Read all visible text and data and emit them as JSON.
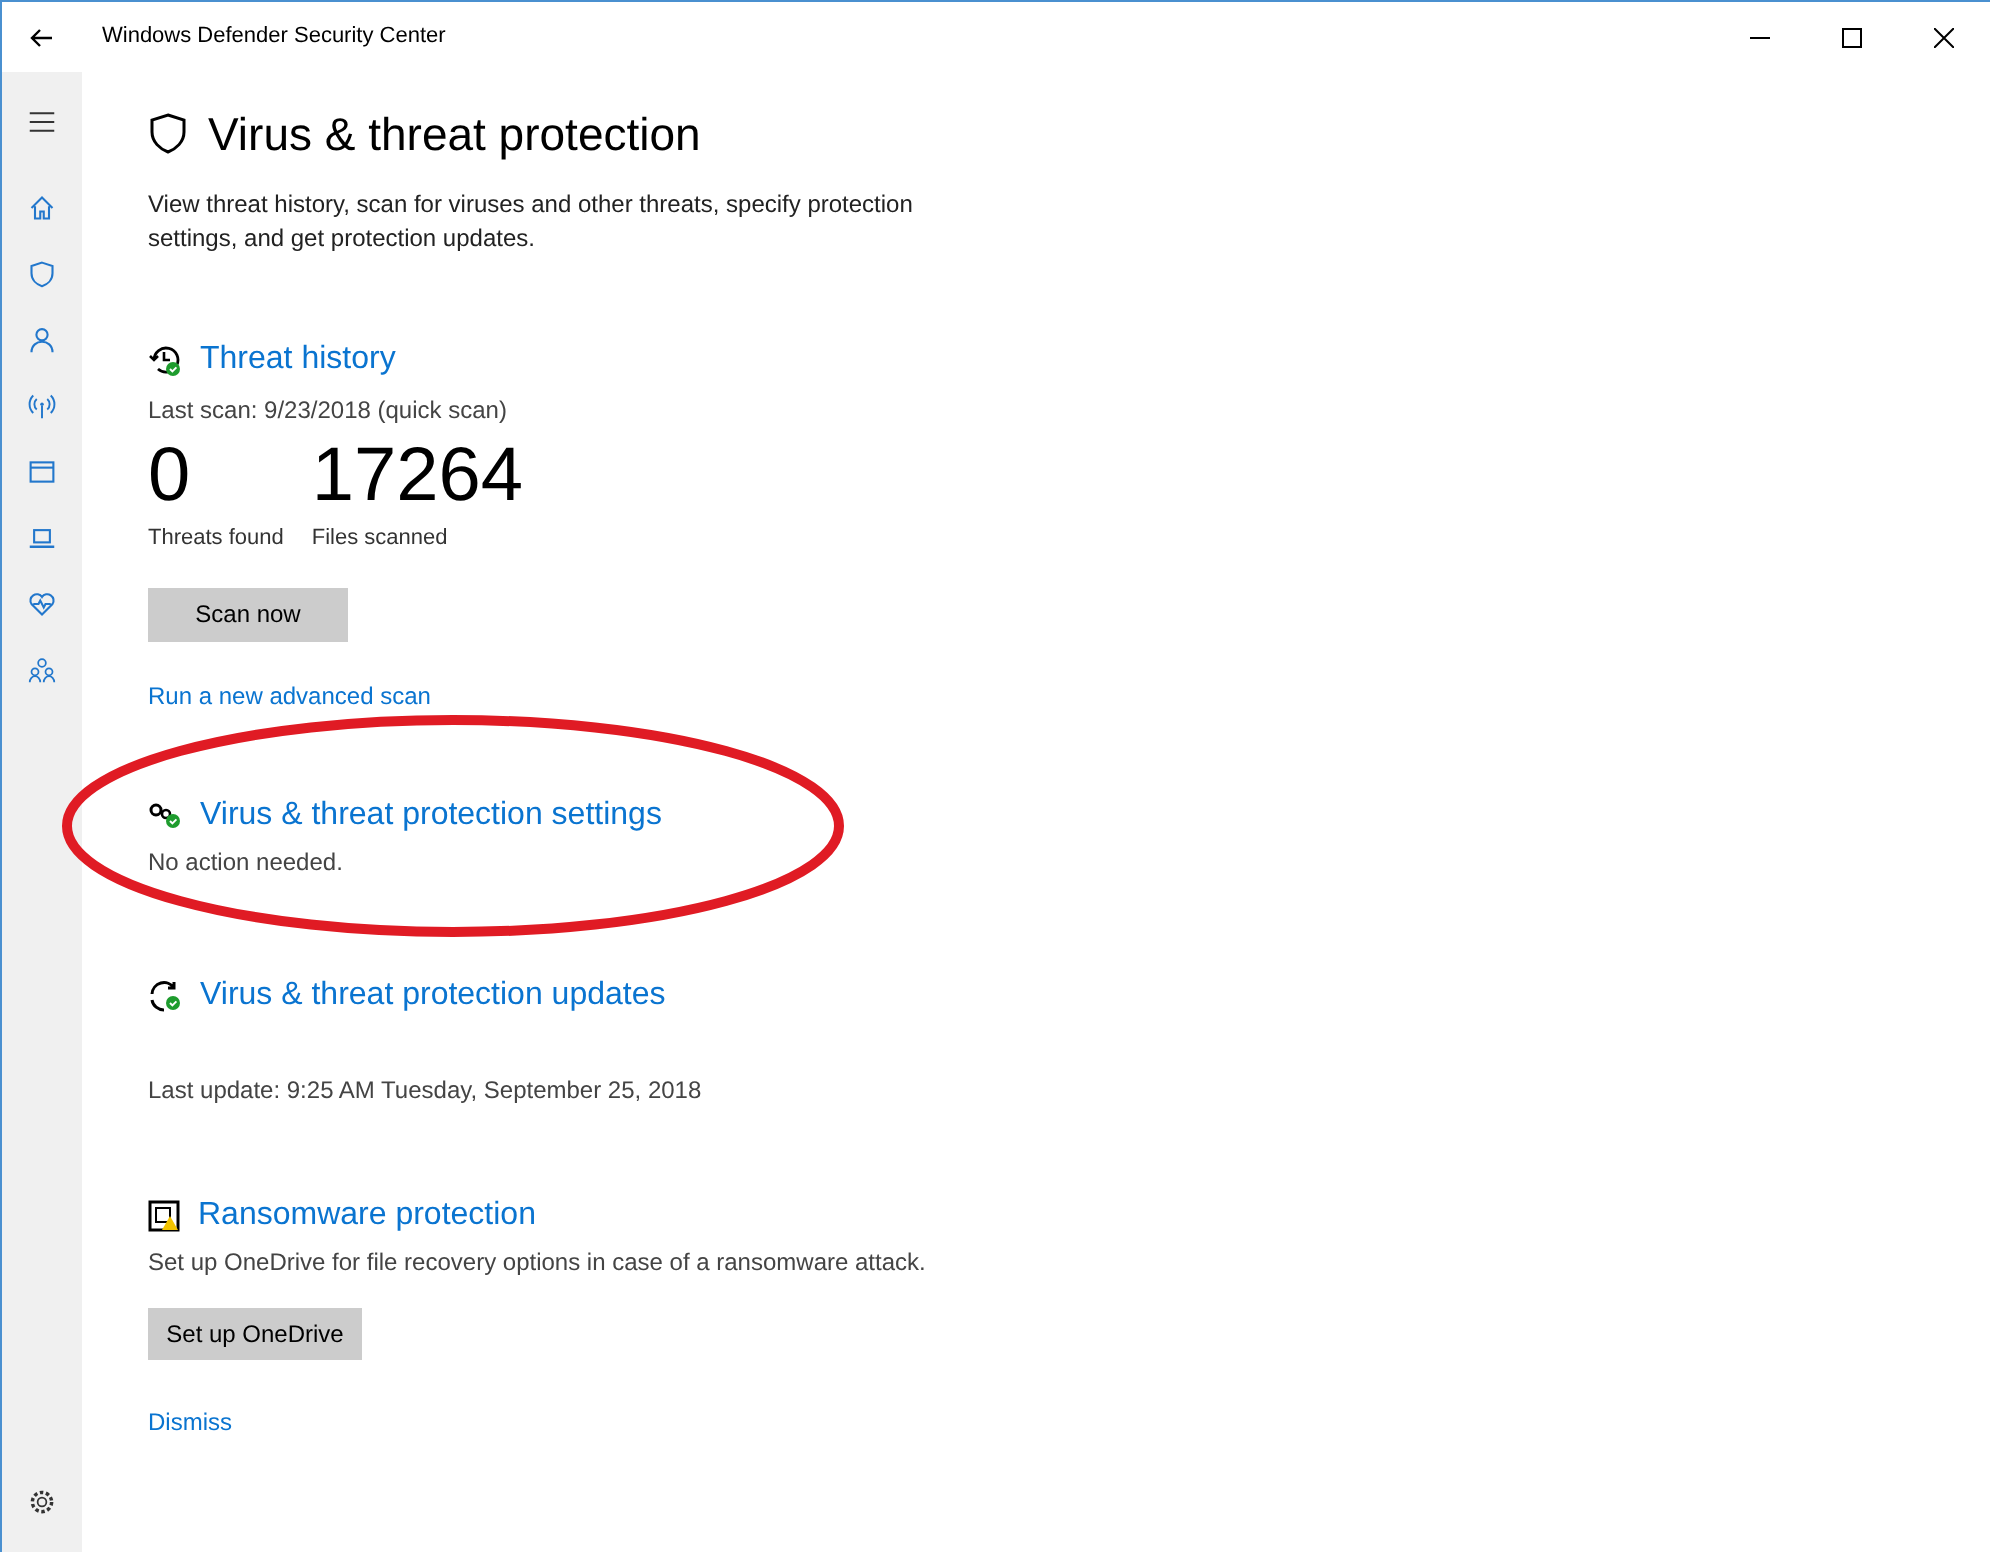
{
  "window": {
    "title": "Windows Defender Security Center"
  },
  "page": {
    "title": "Virus & threat protection",
    "description": "View threat history, scan for viruses and other threats, specify protection settings, and get protection updates."
  },
  "threat_history": {
    "title": "Threat history",
    "last_scan": "Last scan: 9/23/2018 (quick scan)",
    "stats": [
      {
        "value": "0",
        "label": "Threats found"
      },
      {
        "value": "17264",
        "label": "Files scanned"
      }
    ],
    "button": "Scan now",
    "link": "Run a new advanced scan"
  },
  "settings": {
    "title": "Virus & threat protection settings",
    "status": "No action needed.",
    "highlighted": true
  },
  "updates": {
    "title": "Virus & threat protection updates",
    "last_update": "Last update: 9:25 AM Tuesday, September 25, 2018"
  },
  "ransomware": {
    "title": "Ransomware protection",
    "description": "Set up OneDrive for file recovery options in case of a ransomware attack.",
    "button": "Set up OneDrive",
    "link": "Dismiss"
  }
}
